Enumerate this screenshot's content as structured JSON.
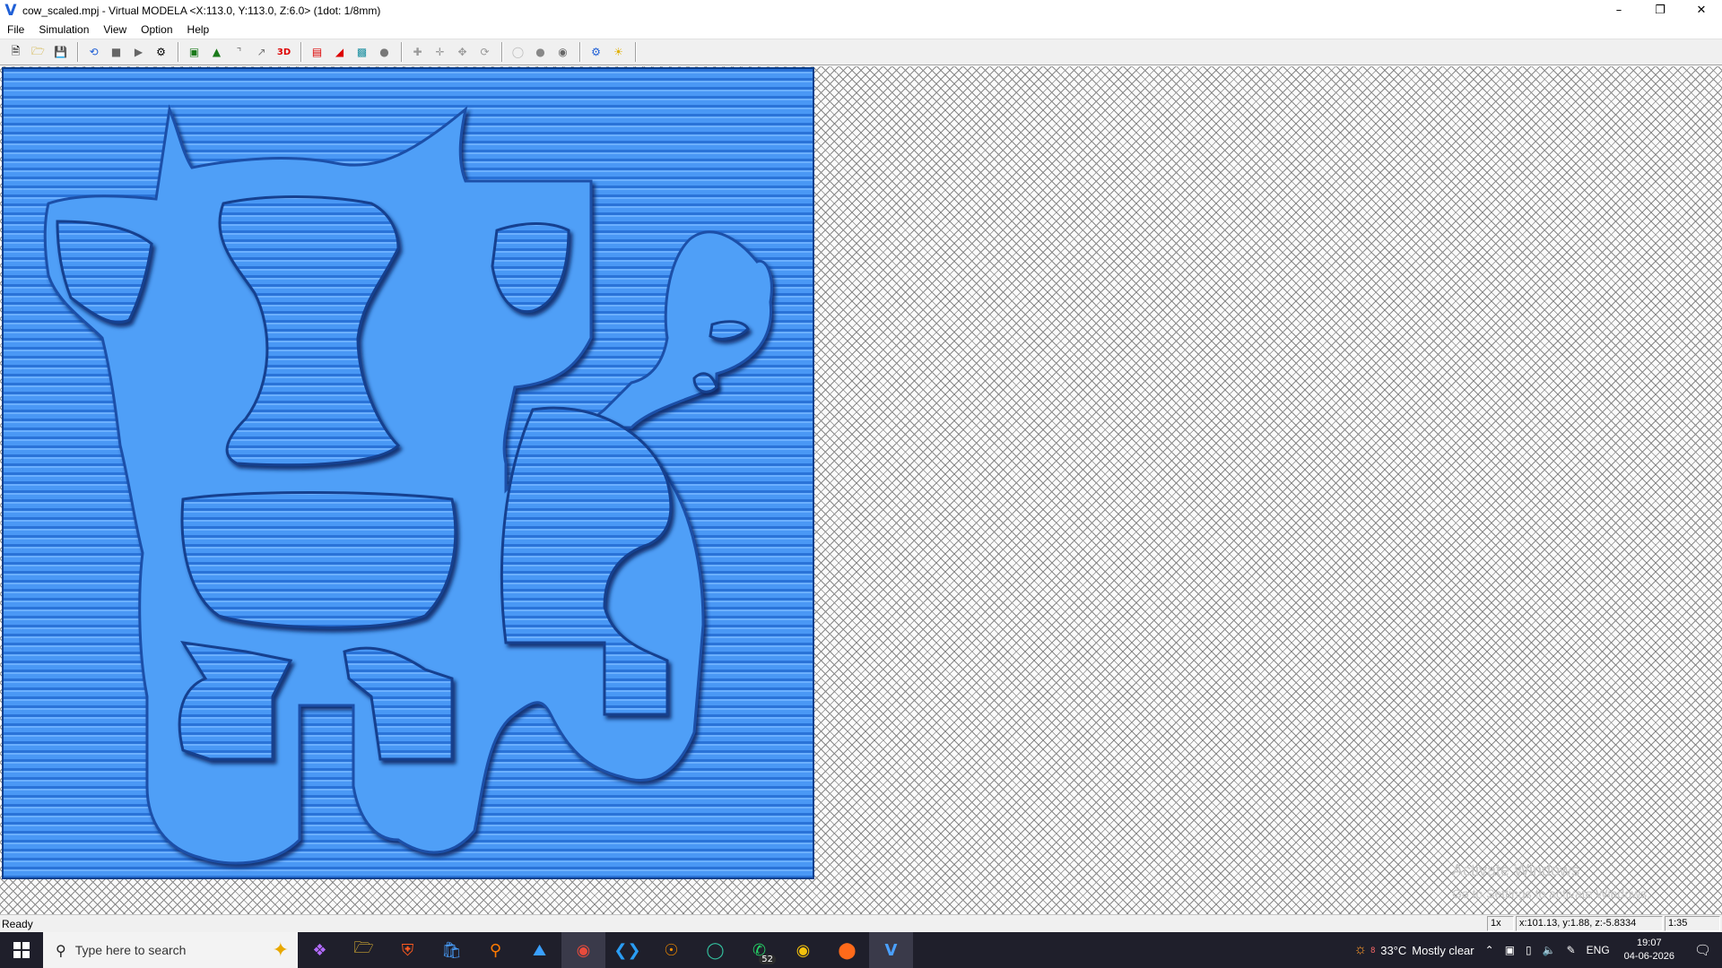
{
  "window": {
    "title": "cow_scaled.mpj - Virtual MODELA <X:113.0, Y:113.0, Z:6.0> (1dot: 1/8mm)",
    "controls": [
      "minimize",
      "restore",
      "close"
    ]
  },
  "menu": [
    "File",
    "Simulation",
    "View",
    "Option",
    "Help"
  ],
  "toolbar": {
    "groups": [
      [
        "new-icon",
        "open-icon",
        "save-icon"
      ],
      [
        "reload-icon",
        "stop-icon",
        "play-icon",
        "step-icon"
      ],
      [
        "view-top-icon",
        "view-side-icon",
        "path-icon",
        "path2-icon",
        "3d-view-icon"
      ],
      [
        "section-icon",
        "color-icon",
        "fit-icon",
        "sphere-icon"
      ],
      [
        "zoom-in-icon",
        "zoom-out-icon",
        "pan-icon",
        "rotate-icon"
      ],
      [
        "light1-icon",
        "light2-icon",
        "light3-icon"
      ],
      [
        "settings-icon",
        "sun-icon"
      ]
    ]
  },
  "watermark": {
    "line1": "Activate Windows",
    "line2": "Go to Settings to activate Windows."
  },
  "status": {
    "text": "Ready",
    "zoom": "1x",
    "coords": "x:101.13, y:1.88, z:-5.8334",
    "scale": "1:35"
  },
  "taskbar": {
    "search_placeholder": "Type here to search",
    "apps": [
      "copilot",
      "file-explorer",
      "brave",
      "store",
      "search-app",
      "photos",
      "chrome-profile",
      "vscode",
      "blender",
      "edge",
      "whatsapp",
      "chrome",
      "app-orange",
      "virtual-modela"
    ],
    "whatsapp_badge": "52",
    "weather_temp": "33°C",
    "weather_text": "Mostly clear",
    "weather_badge": "8",
    "language": "ENG",
    "time": "19:07",
    "date": "04-06-2026"
  },
  "colors": {
    "model_blue": "#3f8ef0",
    "model_border": "#0b3f8c",
    "taskbar_bg": "#1f1f2b"
  }
}
